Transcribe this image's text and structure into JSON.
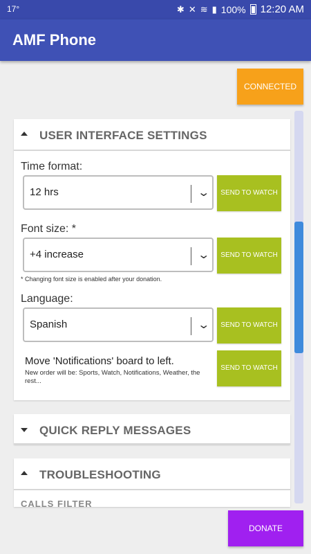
{
  "status_bar": {
    "temperature": "17°",
    "bluetooth_icon": "✱",
    "mute_icon": "✕",
    "wifi_icon": "≋",
    "signal_icon": "▮",
    "battery": "100%",
    "time": "12:20 AM"
  },
  "app_bar": {
    "title": "AMF Phone"
  },
  "connection": {
    "label": "CONNECTED",
    "color": "#f7a11a"
  },
  "ui_settings": {
    "header": "USER INTERFACE SETTINGS",
    "time_format": {
      "label": "Time format:",
      "value": "12 hrs",
      "button": "SEND TO WATCH"
    },
    "font_size": {
      "label": "Font size: *",
      "value": "+4 increase",
      "button": "SEND TO WATCH",
      "note": "* Changing font size is enabled after your donation."
    },
    "language": {
      "label": "Language:",
      "value": "Spanish",
      "button": "SEND TO WATCH"
    },
    "move_notifications": {
      "title": "Move 'Notifications' board to left.",
      "description": "New order will be: Sports, Watch, Notifications, Weather, the rest...",
      "button": "SEND TO WATCH"
    }
  },
  "quick_reply": {
    "header": "QUICK REPLY MESSAGES"
  },
  "troubleshooting": {
    "header": "TROUBLESHOOTING",
    "partial_text": "CALLS FILTER"
  },
  "donate": {
    "label": "DONATE",
    "color": "#a020f0"
  },
  "accent_colors": {
    "primary": "#3f51b5",
    "send_button": "#a8c020"
  }
}
